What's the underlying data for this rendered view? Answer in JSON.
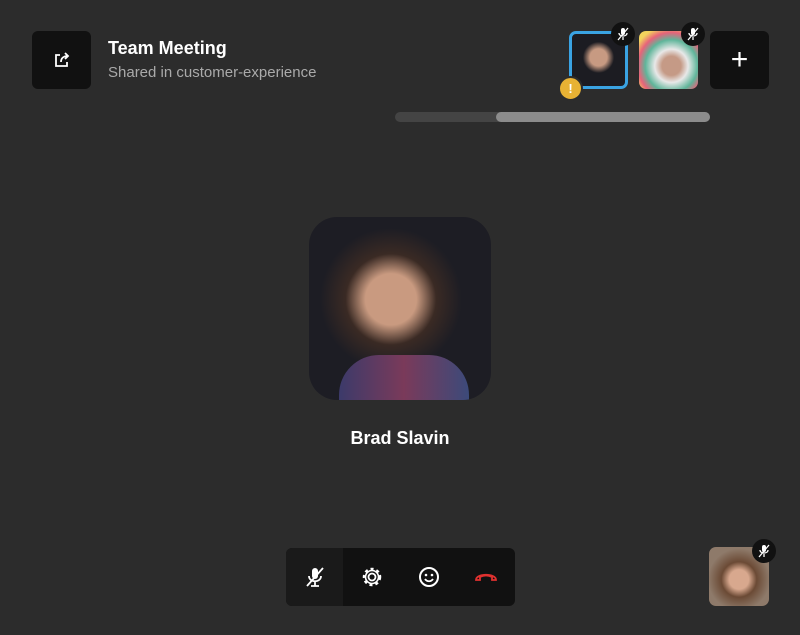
{
  "header": {
    "title": "Team Meeting",
    "subtitle": "Shared in customer-experience",
    "share_icon": "share-icon"
  },
  "participants": [
    {
      "name": "Brad Slavin",
      "active": true,
      "muted": true,
      "warning": true
    },
    {
      "muted": true
    },
    {
      "muted": true,
      "self": true
    }
  ],
  "add_label": "+",
  "main": {
    "speaker_name": "Brad Slavin"
  },
  "colors": {
    "accent": "#3aa3e3",
    "warning": "#e8b234",
    "hangup": "#e0312f"
  },
  "controls": [
    "mic-muted-icon",
    "gear-icon",
    "emoji-icon",
    "hangup-icon"
  ]
}
